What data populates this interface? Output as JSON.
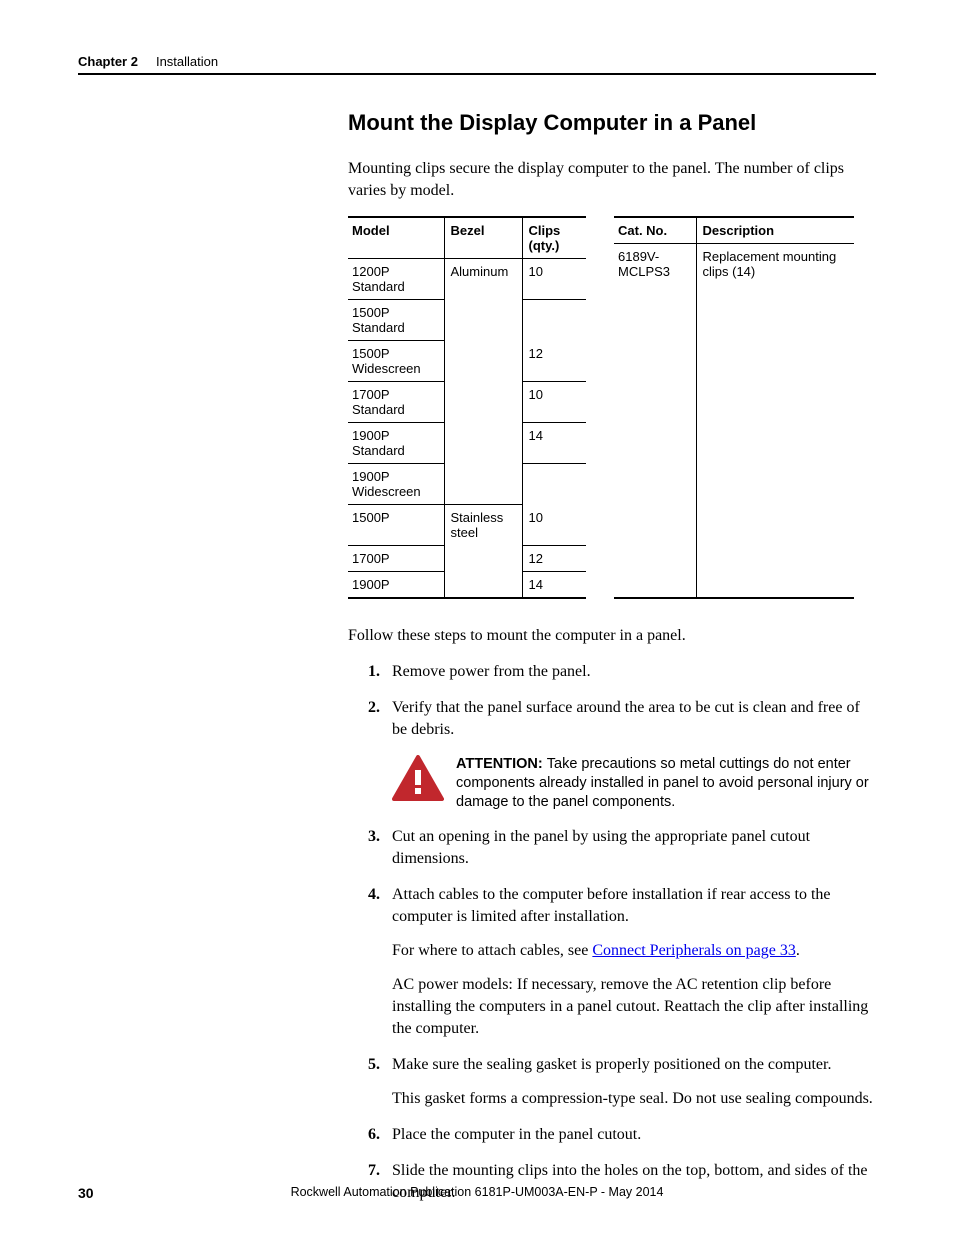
{
  "header": {
    "chapter_label": "Chapter 2",
    "chapter_title": "Installation"
  },
  "section_title": "Mount the Display Computer in a Panel",
  "intro": "Mounting clips secure the display computer to the panel. The number of clips varies by model.",
  "table1": {
    "h1": "Model",
    "h2": "Bezel",
    "h3": "Clips (qty.)",
    "rows": [
      {
        "model": "1200P Standard",
        "bezel": "Aluminum",
        "clips": "10"
      },
      {
        "model": "1500P Standard",
        "bezel": "",
        "clips": ""
      },
      {
        "model": "1500P Widescreen",
        "bezel": "",
        "clips": "12"
      },
      {
        "model": "1700P Standard",
        "bezel": "",
        "clips": "10"
      },
      {
        "model": "1900P Standard",
        "bezel": "",
        "clips": "14"
      },
      {
        "model": "1900P Widescreen",
        "bezel": "",
        "clips": ""
      },
      {
        "model": "1500P",
        "bezel": "Stainless steel",
        "clips": "10"
      },
      {
        "model": "1700P",
        "bezel": "",
        "clips": "12"
      },
      {
        "model": "1900P",
        "bezel": "",
        "clips": "14"
      }
    ]
  },
  "table2": {
    "h1": "Cat. No.",
    "h2": "Description",
    "rows": [
      {
        "cat": "6189V-MCLPS3",
        "desc": "Replacement mounting clips (14)"
      }
    ]
  },
  "follow": "Follow these steps to mount the computer in a panel.",
  "steps": {
    "s1": "Remove power from the panel.",
    "s2": "Verify that the panel surface around the area to be cut is clean and free of be debris.",
    "s3": "Cut an opening in the panel by using the appropriate panel cutout dimensions.",
    "s4": "Attach cables to the computer before installation if rear access to the computer is limited after installation.",
    "s4_a_pre": "For where to attach cables, see ",
    "s4_a_link": "Connect Peripherals on page 33",
    "s4_a_post": ".",
    "s4_b": "AC power models: If necessary, remove the AC retention clip before installing the computers in a panel cutout. Reattach the clip after installing the computer.",
    "s5": "Make sure the sealing gasket is properly positioned on the computer.",
    "s5_a": "This gasket forms a compression-type seal. Do not use sealing compounds.",
    "s6": "Place the computer in the panel cutout.",
    "s7": "Slide the mounting clips into the holes on the top, bottom, and sides of the computer."
  },
  "attention": {
    "label": "ATTENTION: ",
    "text": "Take precautions so metal cuttings do not enter components already installed in panel to avoid personal injury or damage to the panel components."
  },
  "footer": {
    "page": "30",
    "publication": "Rockwell Automation Publication 6181P-UM003A-EN-P - May 2014"
  }
}
